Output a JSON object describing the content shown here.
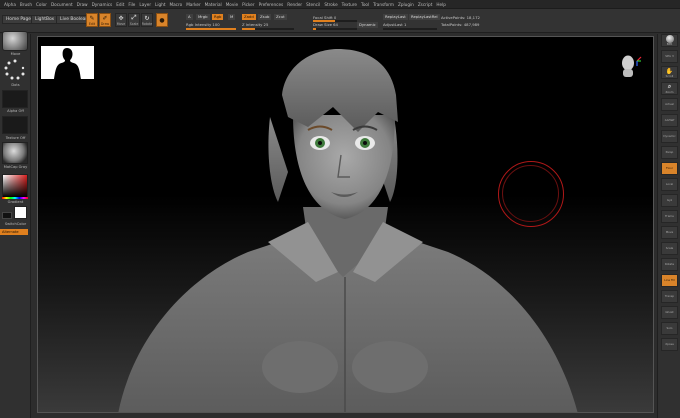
{
  "menu": [
    "Alpha",
    "Brush",
    "Color",
    "Document",
    "Draw",
    "Dynamics",
    "Edit",
    "File",
    "Layer",
    "Light",
    "Macro",
    "Marker",
    "Material",
    "Movie",
    "Picker",
    "Preferences",
    "Render",
    "Stencil",
    "Stroke",
    "Texture",
    "Tool",
    "Transform",
    "Zplugin",
    "Zscript",
    "Help"
  ],
  "shelf": {
    "home_page": "Home Page",
    "lightbox": "LightBox",
    "live_boolean": "Live Boolean",
    "edit": "Edit",
    "draw": "Draw",
    "move": "Move",
    "scale": "Scale",
    "rotate": "Rotate",
    "mrgb": "Mrgb",
    "rgb": "Rgb",
    "m": "M",
    "zadd": "Zadd",
    "zsub": "Zsub",
    "zcut": "Zcut",
    "a_btn": "A",
    "rgb_intensity": "Rgb Intensity 100",
    "z_intensity": "Z Intensity 25",
    "focal_shift": "Focal Shift 0",
    "draw_size": "Draw Size 64",
    "dynamic": "Dynamic",
    "replay_last": "ReplayLast",
    "replay_last_rel": "ReplayLastRel",
    "active_points": "ActivePoints: 18,172",
    "adjust_last": "AdjustLast 1",
    "total_points": "TotalPoints: 487,989",
    "rgb_intensity_level": 1.0,
    "z_intensity_level": 0.25,
    "focal_shift_level": 0.5,
    "draw_size_level": 0.06
  },
  "left": {
    "brush_label": "Move",
    "stroke_label": "Dots",
    "alpha_label": "Alpha Off",
    "texture_label": "Texture Off",
    "material_label": "MatCap Gray",
    "gradient_label": "Gradient",
    "switch_color": "SwitchColor",
    "alternate": "Alternate"
  },
  "right": {
    "buttons": [
      "BPR",
      "SPix 3",
      "Scroll",
      "Zoom",
      "Actual",
      "AAHalf",
      "Dynamic",
      "Persp",
      "Floor",
      "Local",
      "Gyz",
      "Frame",
      "Move",
      "Scale",
      "Rotate",
      "Line Fill",
      "Transp",
      "Ghost",
      "Solo",
      "Xpose"
    ]
  },
  "colors": {
    "accent": "#e0801e",
    "brush_cursor": "#b01818"
  }
}
